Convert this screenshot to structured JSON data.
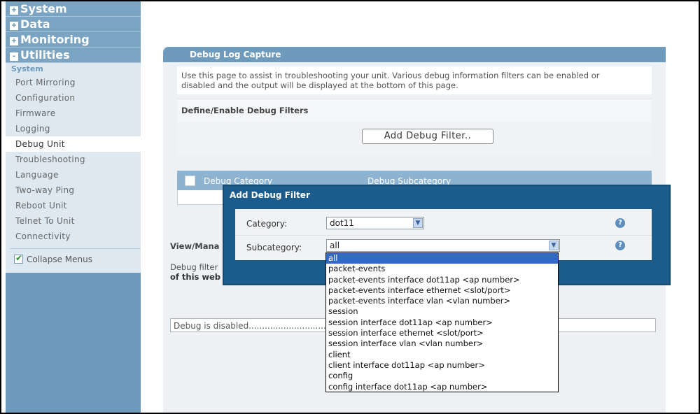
{
  "sidebar": {
    "menus": [
      {
        "label": "System",
        "state": "+"
      },
      {
        "label": "Data",
        "state": "+"
      },
      {
        "label": "Monitoring",
        "state": "+"
      },
      {
        "label": "Utilities",
        "state": "-"
      }
    ],
    "group_label": "System",
    "items": [
      {
        "label": "Port Mirroring"
      },
      {
        "label": "Configuration"
      },
      {
        "label": "Firmware"
      },
      {
        "label": "Logging"
      },
      {
        "label": "Debug Unit"
      },
      {
        "label": "Troubleshooting"
      },
      {
        "label": "Language"
      },
      {
        "label": "Two-way Ping"
      },
      {
        "label": "Reboot Unit"
      },
      {
        "label": "Telnet To Unit"
      },
      {
        "label": "Connectivity"
      }
    ],
    "collapse_label": "Collapse Menus"
  },
  "panel": {
    "title": "Debug Log Capture",
    "intro_line1": "Use this page to assist in troubleshooting your unit. Various debug information filters can be enabled or",
    "intro_line2": "disabled and the output will be displayed at the bottom of this page.",
    "filters_heading": "Define/Enable Debug Filters",
    "add_button": "Add Debug Filter..",
    "table": {
      "col1": "Debug Category",
      "col2": "Debug Subcategory"
    },
    "view_heading": "View/Mana",
    "view_text1": "Debug filter",
    "view_text2": "of this web",
    "debug_status": "Debug is disabled......................................."
  },
  "dialog": {
    "title": "Add Debug Filter",
    "category_label": "Category:",
    "category_value": "dot11",
    "subcategory_label": "Subcategory:",
    "subcategory_value": "all",
    "help_icon": "?"
  },
  "dropdown": {
    "options": [
      "all",
      "packet-events",
      "packet-events interface dot11ap <ap number>",
      "packet-events interface ethernet <slot/port>",
      "packet-events interface vlan <vlan number>",
      "session",
      "session interface dot11ap <ap number>",
      "session interface ethernet <slot/port>",
      "session interface vlan <vlan number>",
      "client",
      "client interface dot11ap <ap number>",
      "config",
      "config interface dot11ap <ap number>"
    ],
    "selected": "all"
  },
  "colors": {
    "sidebar": "#6e9bbb",
    "dialog": "#1c5c8c",
    "selection": "#3169c6"
  }
}
